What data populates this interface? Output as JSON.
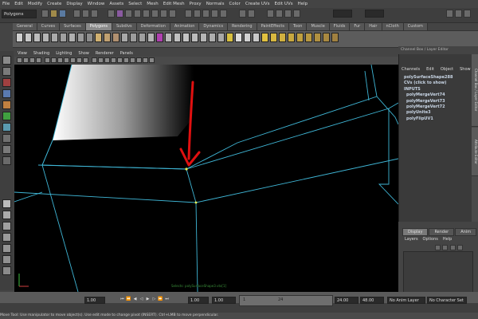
{
  "menubar": [
    "File",
    "Edit",
    "Modify",
    "Create",
    "Display",
    "Window",
    "Assets",
    "Select",
    "Mesh",
    "Edit Mesh",
    "Proxy",
    "Normals",
    "Color",
    "Create UVs",
    "Edit UVs",
    "Help"
  ],
  "status": {
    "mode": "Polygons"
  },
  "shelf": {
    "tabs": [
      "General",
      "Curves",
      "Surfaces",
      "Polygons",
      "Subdivs",
      "Deformation",
      "Animation",
      "Dynamics",
      "Rendering",
      "PaintEffects",
      "Toon",
      "Muscle",
      "Fluids",
      "Fur",
      "Hair",
      "nCloth",
      "Custom"
    ],
    "active_tab": "Polygons"
  },
  "viewport": {
    "menu": [
      "View",
      "Shading",
      "Lighting",
      "Show",
      "Renderer",
      "Panels"
    ],
    "caption": "Selects: polySurfaceShape3.vtx[1]",
    "wire_color": "#3fb6d6",
    "arrow_color": "#e01010"
  },
  "channel_box": {
    "title": "Channel Box / Layer Editor",
    "menu": [
      "Channels",
      "Edit",
      "Object",
      "Show"
    ],
    "object": "polySurfaceShape288",
    "cvs": "CVs (click to show)",
    "inputs_label": "INPUTS",
    "inputs": [
      "polyMergeVert74",
      "polyMergeVert73",
      "polyMergeVert72",
      "polyUnite3",
      "polyFlipUV1"
    ],
    "side_tabs": [
      "Channel Box / Layer Editor",
      "Attribute Editor"
    ]
  },
  "layer_editor": {
    "tabs": [
      "Display",
      "Render",
      "Anim"
    ],
    "active_tab": "Display",
    "menu": [
      "Layers",
      "Options",
      "Help"
    ]
  },
  "time": {
    "start": "1.00",
    "current": "1.00",
    "range_start": "1.00",
    "range_inner": "1",
    "range_inner_end": "24",
    "end": "24.00",
    "anim_end": "48.00",
    "anim_layer": "No Anim Layer",
    "character_set": "No Character Set"
  },
  "helpline": "Move Tool: Use manipulator to move object(s). Use edit mode to change pivot (INSERT). Ctrl+LMB to move perpendicular."
}
